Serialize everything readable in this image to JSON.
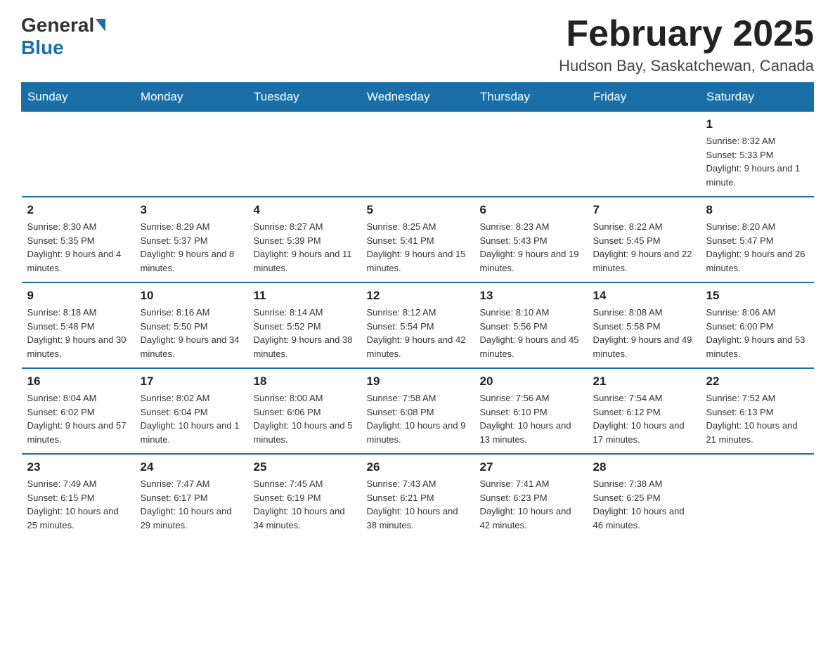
{
  "header": {
    "logo_general": "General",
    "logo_blue": "Blue",
    "month_title": "February 2025",
    "location": "Hudson Bay, Saskatchewan, Canada"
  },
  "weekdays": [
    "Sunday",
    "Monday",
    "Tuesday",
    "Wednesday",
    "Thursday",
    "Friday",
    "Saturday"
  ],
  "weeks": [
    [
      {
        "day": "",
        "info": "",
        "empty": true
      },
      {
        "day": "",
        "info": "",
        "empty": true
      },
      {
        "day": "",
        "info": "",
        "empty": true
      },
      {
        "day": "",
        "info": "",
        "empty": true
      },
      {
        "day": "",
        "info": "",
        "empty": true
      },
      {
        "day": "",
        "info": "",
        "empty": true
      },
      {
        "day": "1",
        "info": "Sunrise: 8:32 AM\nSunset: 5:33 PM\nDaylight: 9 hours and 1 minute.",
        "empty": false
      }
    ],
    [
      {
        "day": "2",
        "info": "Sunrise: 8:30 AM\nSunset: 5:35 PM\nDaylight: 9 hours and 4 minutes.",
        "empty": false
      },
      {
        "day": "3",
        "info": "Sunrise: 8:29 AM\nSunset: 5:37 PM\nDaylight: 9 hours and 8 minutes.",
        "empty": false
      },
      {
        "day": "4",
        "info": "Sunrise: 8:27 AM\nSunset: 5:39 PM\nDaylight: 9 hours and 11 minutes.",
        "empty": false
      },
      {
        "day": "5",
        "info": "Sunrise: 8:25 AM\nSunset: 5:41 PM\nDaylight: 9 hours and 15 minutes.",
        "empty": false
      },
      {
        "day": "6",
        "info": "Sunrise: 8:23 AM\nSunset: 5:43 PM\nDaylight: 9 hours and 19 minutes.",
        "empty": false
      },
      {
        "day": "7",
        "info": "Sunrise: 8:22 AM\nSunset: 5:45 PM\nDaylight: 9 hours and 22 minutes.",
        "empty": false
      },
      {
        "day": "8",
        "info": "Sunrise: 8:20 AM\nSunset: 5:47 PM\nDaylight: 9 hours and 26 minutes.",
        "empty": false
      }
    ],
    [
      {
        "day": "9",
        "info": "Sunrise: 8:18 AM\nSunset: 5:48 PM\nDaylight: 9 hours and 30 minutes.",
        "empty": false
      },
      {
        "day": "10",
        "info": "Sunrise: 8:16 AM\nSunset: 5:50 PM\nDaylight: 9 hours and 34 minutes.",
        "empty": false
      },
      {
        "day": "11",
        "info": "Sunrise: 8:14 AM\nSunset: 5:52 PM\nDaylight: 9 hours and 38 minutes.",
        "empty": false
      },
      {
        "day": "12",
        "info": "Sunrise: 8:12 AM\nSunset: 5:54 PM\nDaylight: 9 hours and 42 minutes.",
        "empty": false
      },
      {
        "day": "13",
        "info": "Sunrise: 8:10 AM\nSunset: 5:56 PM\nDaylight: 9 hours and 45 minutes.",
        "empty": false
      },
      {
        "day": "14",
        "info": "Sunrise: 8:08 AM\nSunset: 5:58 PM\nDaylight: 9 hours and 49 minutes.",
        "empty": false
      },
      {
        "day": "15",
        "info": "Sunrise: 8:06 AM\nSunset: 6:00 PM\nDaylight: 9 hours and 53 minutes.",
        "empty": false
      }
    ],
    [
      {
        "day": "16",
        "info": "Sunrise: 8:04 AM\nSunset: 6:02 PM\nDaylight: 9 hours and 57 minutes.",
        "empty": false
      },
      {
        "day": "17",
        "info": "Sunrise: 8:02 AM\nSunset: 6:04 PM\nDaylight: 10 hours and 1 minute.",
        "empty": false
      },
      {
        "day": "18",
        "info": "Sunrise: 8:00 AM\nSunset: 6:06 PM\nDaylight: 10 hours and 5 minutes.",
        "empty": false
      },
      {
        "day": "19",
        "info": "Sunrise: 7:58 AM\nSunset: 6:08 PM\nDaylight: 10 hours and 9 minutes.",
        "empty": false
      },
      {
        "day": "20",
        "info": "Sunrise: 7:56 AM\nSunset: 6:10 PM\nDaylight: 10 hours and 13 minutes.",
        "empty": false
      },
      {
        "day": "21",
        "info": "Sunrise: 7:54 AM\nSunset: 6:12 PM\nDaylight: 10 hours and 17 minutes.",
        "empty": false
      },
      {
        "day": "22",
        "info": "Sunrise: 7:52 AM\nSunset: 6:13 PM\nDaylight: 10 hours and 21 minutes.",
        "empty": false
      }
    ],
    [
      {
        "day": "23",
        "info": "Sunrise: 7:49 AM\nSunset: 6:15 PM\nDaylight: 10 hours and 25 minutes.",
        "empty": false
      },
      {
        "day": "24",
        "info": "Sunrise: 7:47 AM\nSunset: 6:17 PM\nDaylight: 10 hours and 29 minutes.",
        "empty": false
      },
      {
        "day": "25",
        "info": "Sunrise: 7:45 AM\nSunset: 6:19 PM\nDaylight: 10 hours and 34 minutes.",
        "empty": false
      },
      {
        "day": "26",
        "info": "Sunrise: 7:43 AM\nSunset: 6:21 PM\nDaylight: 10 hours and 38 minutes.",
        "empty": false
      },
      {
        "day": "27",
        "info": "Sunrise: 7:41 AM\nSunset: 6:23 PM\nDaylight: 10 hours and 42 minutes.",
        "empty": false
      },
      {
        "day": "28",
        "info": "Sunrise: 7:38 AM\nSunset: 6:25 PM\nDaylight: 10 hours and 46 minutes.",
        "empty": false
      },
      {
        "day": "",
        "info": "",
        "empty": true
      }
    ]
  ]
}
